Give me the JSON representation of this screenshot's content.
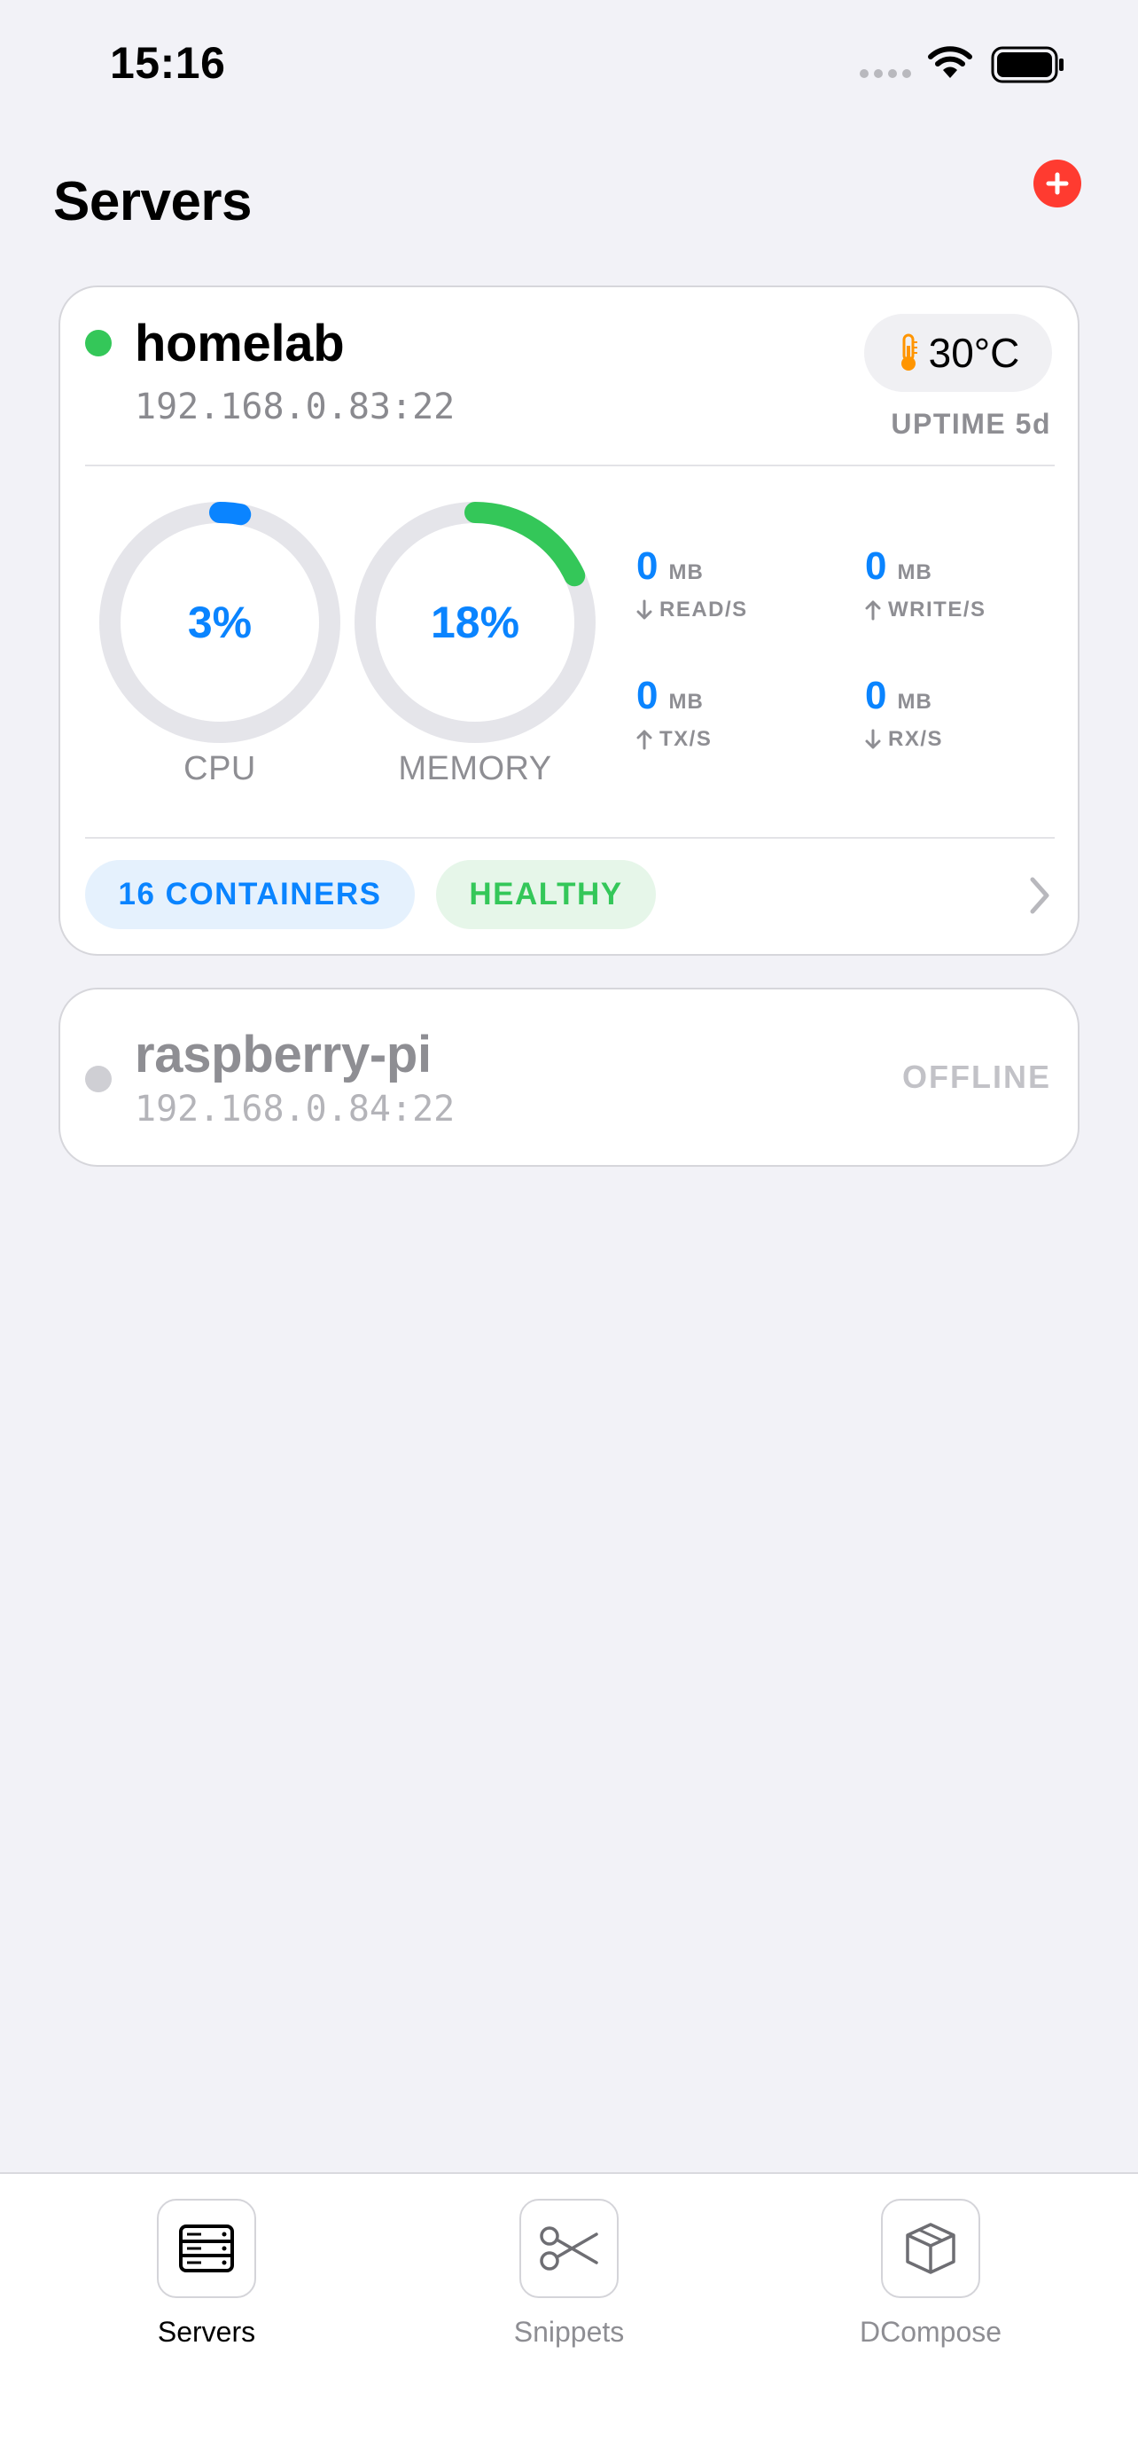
{
  "status_bar": {
    "time": "15:16"
  },
  "header": {
    "title": "Servers"
  },
  "servers": [
    {
      "name": "homelab",
      "address": "192.168.0.83:22",
      "online": true,
      "temperature": "30°C",
      "uptime": "UPTIME 5d",
      "cpu": {
        "value": "3%",
        "fraction": 0.03,
        "label": "CPU"
      },
      "memory": {
        "value": "18%",
        "fraction": 0.18,
        "label": "MEMORY"
      },
      "metrics": {
        "read": {
          "value": "0",
          "unit": "MB",
          "caption": "READ/S"
        },
        "write": {
          "value": "0",
          "unit": "MB",
          "caption": "WRITE/S"
        },
        "tx": {
          "value": "0",
          "unit": "MB",
          "caption": "TX/S"
        },
        "rx": {
          "value": "0",
          "unit": "MB",
          "caption": "RX/S"
        }
      },
      "containers_badge": "16 CONTAINERS",
      "health_badge": "HEALTHY"
    },
    {
      "name": "raspberry-pi",
      "address": "192.168.0.84:22",
      "online": false,
      "status": "OFFLINE"
    }
  ],
  "tabs": [
    {
      "label": "Servers",
      "icon": "server-rack-icon",
      "active": true
    },
    {
      "label": "Snippets",
      "icon": "scissors-icon",
      "active": false
    },
    {
      "label": "DCompose",
      "icon": "cube-icon",
      "active": false
    }
  ],
  "colors": {
    "accent": "#0a84ff",
    "online": "#34c759",
    "offline": "#cfcfd4",
    "danger": "#ff3b30",
    "temperature": "#ff9500",
    "background": "#f2f2f7"
  }
}
